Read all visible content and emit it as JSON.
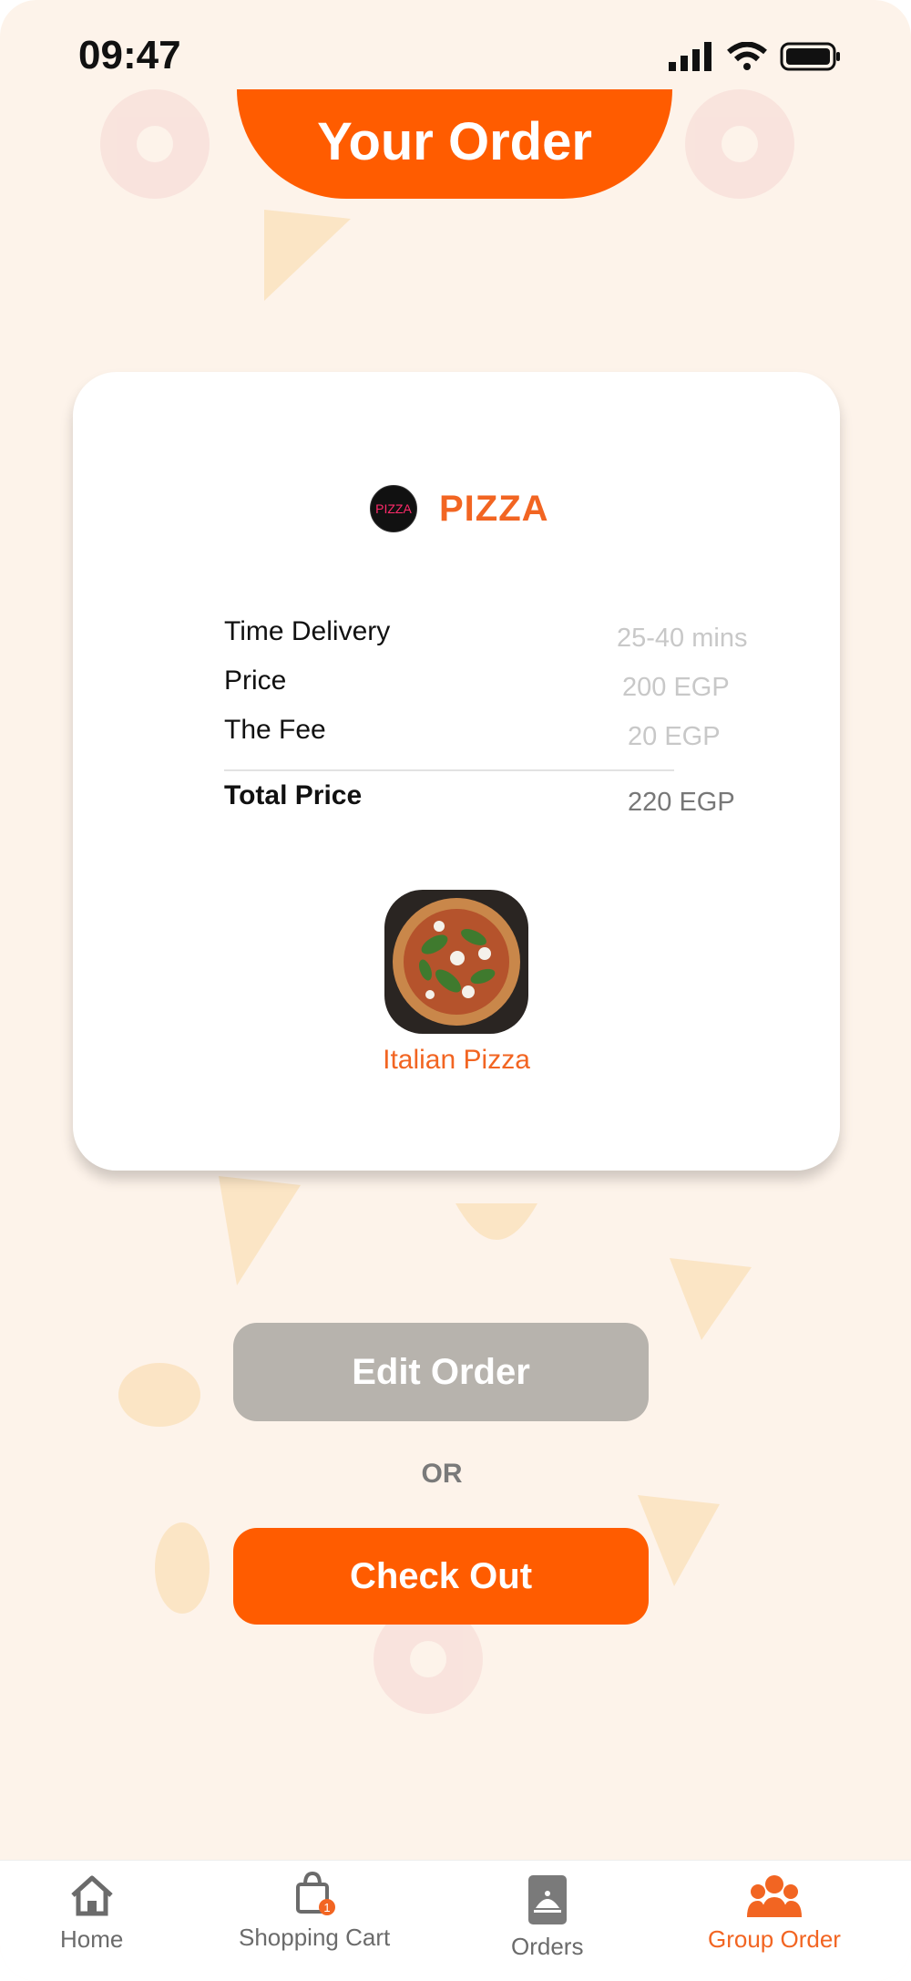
{
  "status_bar": {
    "time": "09:47"
  },
  "header": {
    "title": "Your Order"
  },
  "store": {
    "logo_text": "PIZZA",
    "name": "PIZZA"
  },
  "details": {
    "rows": [
      {
        "label": "Time Delivery",
        "value": "25-40 mins"
      },
      {
        "label": "Price",
        "value": "200 EGP"
      },
      {
        "label": "The Fee",
        "value": "20 EGP"
      }
    ],
    "total": {
      "label": "Total Price",
      "value": "220 EGP"
    }
  },
  "item": {
    "name": "Italian Pizza"
  },
  "actions": {
    "edit_label": "Edit Order",
    "or_label": "OR",
    "checkout_label": "Check Out"
  },
  "nav": {
    "items": [
      {
        "label": "Home",
        "icon": "home-icon"
      },
      {
        "label": "Shopping Cart",
        "icon": "shopping-bag-icon",
        "badge": "1"
      },
      {
        "label": "Orders",
        "icon": "orders-icon"
      },
      {
        "label": "Group Order",
        "icon": "group-icon",
        "active": true
      }
    ]
  },
  "colors": {
    "accent": "#ff5c00",
    "background": "#fdf3ea",
    "edit_button": "#b7b3ad"
  }
}
